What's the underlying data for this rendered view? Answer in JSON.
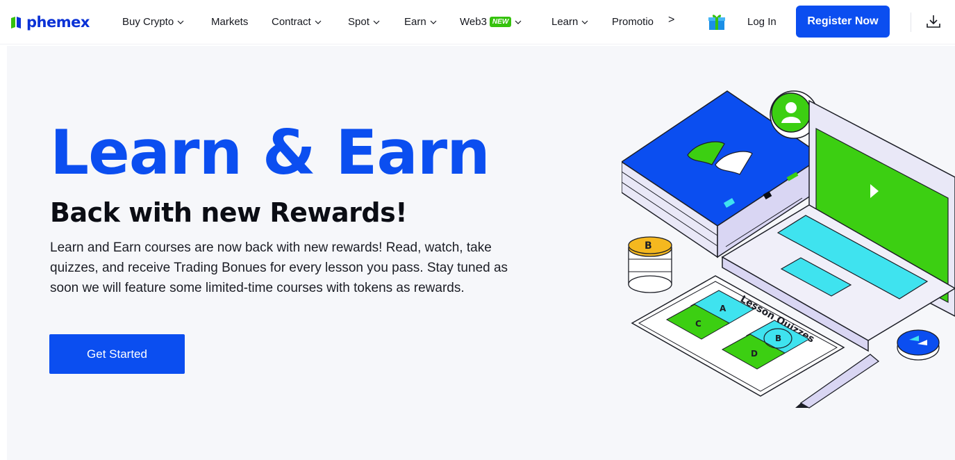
{
  "brand": {
    "name": "phemex",
    "color": "#0b32d6"
  },
  "nav": {
    "items": [
      {
        "label": "Buy Crypto",
        "dropdown": true
      },
      {
        "label": "Markets",
        "dropdown": false
      },
      {
        "label": "Contract",
        "dropdown": true
      },
      {
        "label": "Spot",
        "dropdown": true
      },
      {
        "label": "Earn",
        "dropdown": true
      },
      {
        "label": "Web3",
        "dropdown": true,
        "badge": "NEW"
      },
      {
        "label": "Learn",
        "dropdown": true
      },
      {
        "label": "Promotio",
        "dropdown": false
      }
    ],
    "more_arrow": ">",
    "login": "Log In",
    "register": "Register Now",
    "icons": [
      "gift-icon",
      "download-icon",
      "chevron-down-icon",
      "chevron-right-icon"
    ]
  },
  "hero": {
    "title": "Learn & Earn",
    "subtitle": "Back with new Rewards!",
    "description": "Learn and Earn courses are now back with new rewards! Read, watch, take quizzes, and receive Trading Bonues for every lesson you pass. Stay tuned as soon we will feature some limited-time courses with tokens as rewards.",
    "cta": "Get Started"
  },
  "illustration": {
    "quiz_title": "Lesson Quizzes",
    "options": [
      "A",
      "B",
      "C",
      "D"
    ]
  },
  "colors": {
    "accent": "#0b4ef0",
    "badge_green": "#35c20d",
    "hero_bg": "#f6f7fa",
    "illustration_green": "#3ccf12",
    "illustration_cyan": "#3fe3ef"
  }
}
